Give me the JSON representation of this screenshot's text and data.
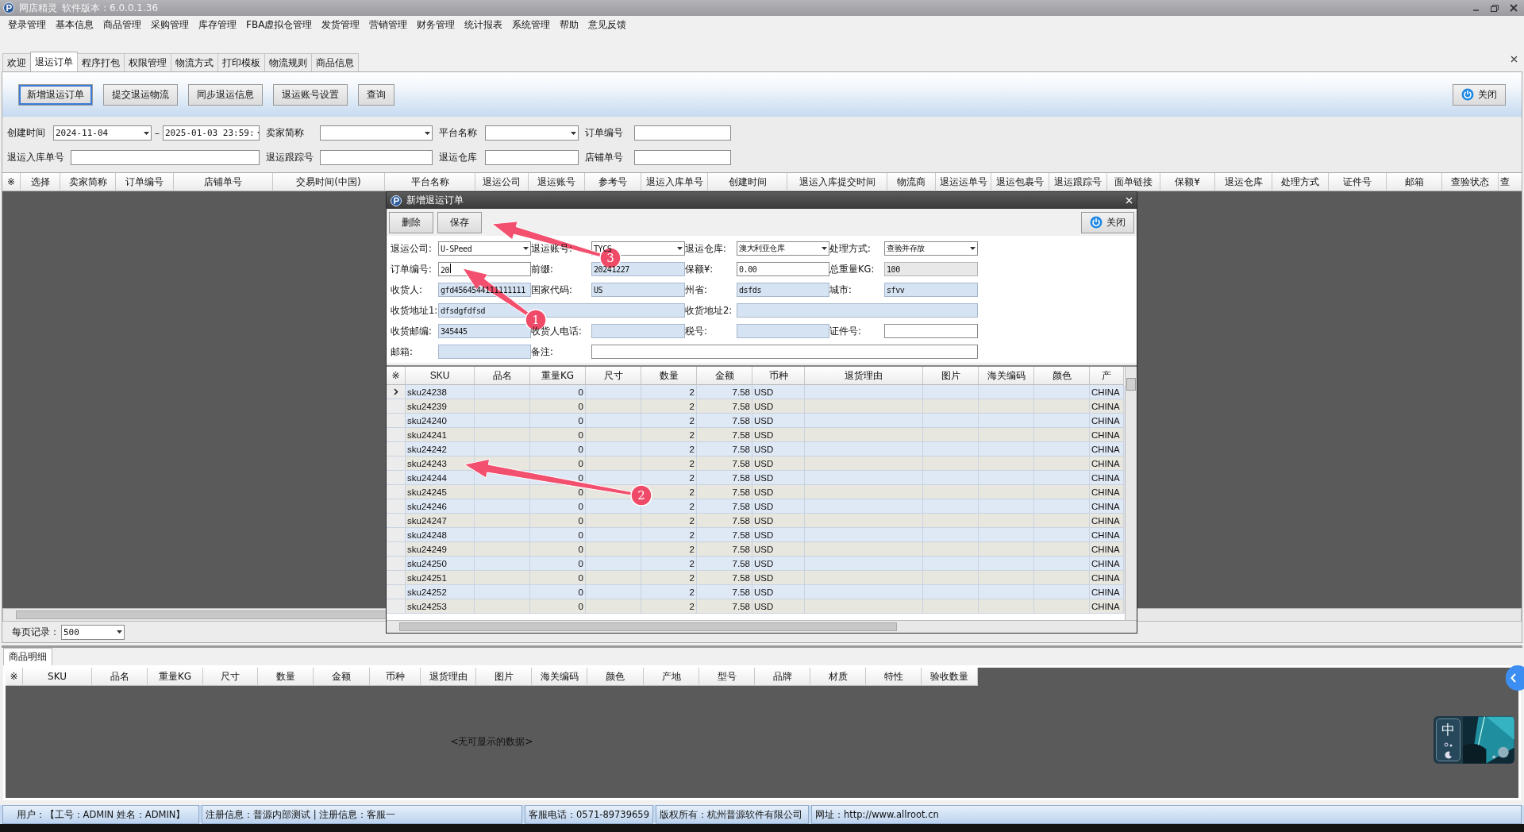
{
  "window": {
    "title": "网店精灵",
    "version": "软件版本：6.0.0.1.36"
  },
  "menu": [
    "登录管理",
    "基本信息",
    "商品管理",
    "采购管理",
    "库存管理",
    "FBA虚拟仓管理",
    "发货管理",
    "营销管理",
    "财务管理",
    "统计报表",
    "系统管理",
    "帮助",
    "意见反馈"
  ],
  "tabs": [
    {
      "label": "欢迎",
      "selected": false
    },
    {
      "label": "退运订单",
      "selected": true
    },
    {
      "label": "程序打包",
      "selected": false
    },
    {
      "label": "权限管理",
      "selected": false
    },
    {
      "label": "物流方式",
      "selected": false
    },
    {
      "label": "打印模板",
      "selected": false
    },
    {
      "label": "物流规则",
      "selected": false
    },
    {
      "label": "商品信息",
      "selected": false
    }
  ],
  "toolbar": {
    "buttons": [
      {
        "label": "新增退运订单",
        "focused": true
      },
      {
        "label": "提交退运物流",
        "focused": false
      },
      {
        "label": "同步退运信息",
        "focused": false
      },
      {
        "label": "退运账号设置",
        "focused": false
      },
      {
        "label": "查询",
        "focused": false
      }
    ],
    "close": "关闭"
  },
  "filters": [
    {
      "label": "创建时间",
      "kind": "daterange",
      "value": "2024-11-04",
      "separator": "–",
      "value_to": "2025-01-03 23:59:"
    },
    {
      "label": "卖家简称",
      "kind": "dropdown"
    },
    {
      "label": "平台名称",
      "kind": "dropdown"
    },
    {
      "label": "订单编号",
      "kind": "text"
    },
    {
      "label": "退运入库单号",
      "kind": "text"
    },
    {
      "label": "退运跟踪号",
      "kind": "text"
    },
    {
      "label": "退运仓库",
      "kind": "text"
    },
    {
      "label": "店铺单号",
      "kind": "text"
    }
  ],
  "orders_table": {
    "columns": [
      "※",
      "选择",
      "卖家简称",
      "订单编号",
      "店铺单号",
      "交易时间(中国)",
      "平台名称",
      "退运公司",
      "退运账号",
      "参考号",
      "退运入库单号",
      "创建时间",
      "退运入库提交时间",
      "物流商",
      "退运运单号",
      "退运包裹号",
      "退运跟踪号",
      "面单链接",
      "保额¥",
      "退运仓库",
      "处理方式",
      "证件号",
      "邮箱",
      "查验状态",
      "查"
    ]
  },
  "pager": {
    "label": "每页记录：",
    "value": "500"
  },
  "detail": {
    "tab": "商品明细",
    "columns": [
      "※",
      "SKU",
      "品名",
      "重量KG",
      "尺寸",
      "数量",
      "金额",
      "币种",
      "退货理由",
      "图片",
      "海关编码",
      "颜色",
      "产地",
      "型号",
      "品牌",
      "材质",
      "特性",
      "验收数量"
    ],
    "empty_message": "<无可显示的数据>"
  },
  "status_bar": [
    "用户：【工号：ADMIN 姓名：ADMIN】",
    "注册信息：普源内部测试 | 注册信息：客服一",
    "客服电话：0571-89739659",
    "版权所有：杭州普源软件有限公司",
    "网址：http://www.allroot.cn"
  ],
  "dialog": {
    "title": "新增退运订单",
    "buttons": [
      "删除",
      "保存"
    ],
    "close": "关闭",
    "form": [
      [
        {
          "label": "退运公司:",
          "kind": "dropdown",
          "value": "U-SPeed"
        },
        {
          "label": "退运账号:",
          "kind": "dropdown",
          "value": "TYCS"
        },
        {
          "label": "退运仓库:",
          "kind": "dropdown",
          "value": "澳大利亚仓库"
        },
        {
          "label": "处理方式:",
          "kind": "dropdown",
          "value": "查验并存放"
        }
      ],
      [
        {
          "label": "订单编号:",
          "kind": "editable",
          "value": "20"
        },
        {
          "label": "前缀:",
          "kind": "readonly",
          "value": "20241227"
        },
        {
          "label": "保额¥:",
          "kind": "editable",
          "value": "0.00"
        },
        {
          "label": "总重量KG:",
          "kind": "disabled",
          "value": "100"
        }
      ],
      [
        {
          "label": "收货人:",
          "kind": "readonly",
          "value": "gfd4564544111111111"
        },
        {
          "label": "国家代码:",
          "kind": "readonly",
          "value": "US"
        },
        {
          "label": "州省:",
          "kind": "readonly",
          "value": "dsfds"
        },
        {
          "label": "城市:",
          "kind": "readonly",
          "value": "sfvv"
        }
      ],
      [
        {
          "label": "收货地址1:",
          "kind": "readonly",
          "value": "dfsdgfdfsd",
          "wide": true
        },
        {
          "label": "收货地址2:",
          "kind": "readonly",
          "wide": true
        }
      ],
      [
        {
          "label": "收货邮编:",
          "kind": "readonly",
          "value": "345445"
        },
        {
          "label": "收货人电话:",
          "kind": "readonly"
        },
        {
          "label": "税号:",
          "kind": "readonly"
        },
        {
          "label": "证件号:",
          "kind": "editable"
        }
      ],
      [
        {
          "label": "邮箱:",
          "kind": "readonly"
        },
        {
          "label": "备注:",
          "kind": "editable",
          "wide": true
        }
      ]
    ],
    "columns": [
      "※",
      "SKU",
      "品名",
      "重量KG",
      "尺寸",
      "数量",
      "金额",
      "币种",
      "退货理由",
      "图片",
      "海关编码",
      "颜色",
      "产"
    ],
    "rows": [
      {
        "sku": "sku24238",
        "weight_kg": "0",
        "quantity": "2",
        "amount": "7.58",
        "currency": "USD",
        "origin": "CHINA",
        "selected": true
      },
      {
        "sku": "sku24239",
        "weight_kg": "0",
        "quantity": "2",
        "amount": "7.58",
        "currency": "USD",
        "origin": "CHINA",
        "selected": false
      },
      {
        "sku": "sku24240",
        "weight_kg": "0",
        "quantity": "2",
        "amount": "7.58",
        "currency": "USD",
        "origin": "CHINA",
        "selected": false
      },
      {
        "sku": "sku24241",
        "weight_kg": "0",
        "quantity": "2",
        "amount": "7.58",
        "currency": "USD",
        "origin": "CHINA",
        "selected": false
      },
      {
        "sku": "sku24242",
        "weight_kg": "0",
        "quantity": "2",
        "amount": "7.58",
        "currency": "USD",
        "origin": "CHINA",
        "selected": false
      },
      {
        "sku": "sku24243",
        "weight_kg": "0",
        "quantity": "2",
        "amount": "7.58",
        "currency": "USD",
        "origin": "CHINA",
        "selected": false
      },
      {
        "sku": "sku24244",
        "weight_kg": "0",
        "quantity": "2",
        "amount": "7.58",
        "currency": "USD",
        "origin": "CHINA",
        "selected": false
      },
      {
        "sku": "sku24245",
        "weight_kg": "0",
        "quantity": "2",
        "amount": "7.58",
        "currency": "USD",
        "origin": "CHINA",
        "selected": false
      },
      {
        "sku": "sku24246",
        "weight_kg": "0",
        "quantity": "2",
        "amount": "7.58",
        "currency": "USD",
        "origin": "CHINA",
        "selected": false
      },
      {
        "sku": "sku24247",
        "weight_kg": "0",
        "quantity": "2",
        "amount": "7.58",
        "currency": "USD",
        "origin": "CHINA",
        "selected": false
      },
      {
        "sku": "sku24248",
        "weight_kg": "0",
        "quantity": "2",
        "amount": "7.58",
        "currency": "USD",
        "origin": "CHINA",
        "selected": false
      },
      {
        "sku": "sku24249",
        "weight_kg": "0",
        "quantity": "2",
        "amount": "7.58",
        "currency": "USD",
        "origin": "CHINA",
        "selected": false
      },
      {
        "sku": "sku24250",
        "weight_kg": "0",
        "quantity": "2",
        "amount": "7.58",
        "currency": "USD",
        "origin": "CHINA",
        "selected": false
      },
      {
        "sku": "sku24251",
        "weight_kg": "0",
        "quantity": "2",
        "amount": "7.58",
        "currency": "USD",
        "origin": "CHINA",
        "selected": false
      },
      {
        "sku": "sku24252",
        "weight_kg": "0",
        "quantity": "2",
        "amount": "7.58",
        "currency": "USD",
        "origin": "CHINA",
        "selected": false
      },
      {
        "sku": "sku24253",
        "weight_kg": "0",
        "quantity": "2",
        "amount": "7.58",
        "currency": "USD",
        "origin": "CHINA",
        "selected": false
      }
    ]
  },
  "annotations": [
    {
      "number": "1"
    },
    {
      "number": "2"
    },
    {
      "number": "3"
    }
  ],
  "ime": {
    "label": "中"
  }
}
